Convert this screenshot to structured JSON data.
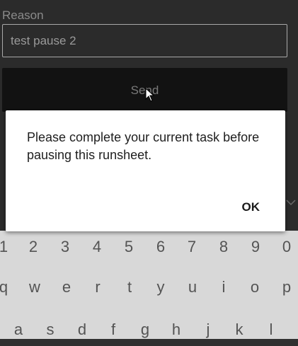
{
  "form": {
    "reason_label": "Reason",
    "reason_value": "test pause 2",
    "send_label": "Send"
  },
  "dialog": {
    "message": "Please complete your current task before pausing this runsheet.",
    "ok_label": "OK"
  },
  "keyboard": {
    "number_row": [
      "1",
      "2",
      "3",
      "4",
      "5",
      "6",
      "7",
      "8",
      "9",
      "0"
    ],
    "top_row": [
      "q",
      "w",
      "e",
      "r",
      "t",
      "y",
      "u",
      "i",
      "o",
      "p"
    ],
    "middle_row": [
      "a",
      "s",
      "d",
      "f",
      "g",
      "h",
      "j",
      "k",
      "l"
    ]
  },
  "colors": {
    "background": "#2b2b2b",
    "dialog": "#ffffff",
    "keyboard": "#d8d8d8"
  }
}
